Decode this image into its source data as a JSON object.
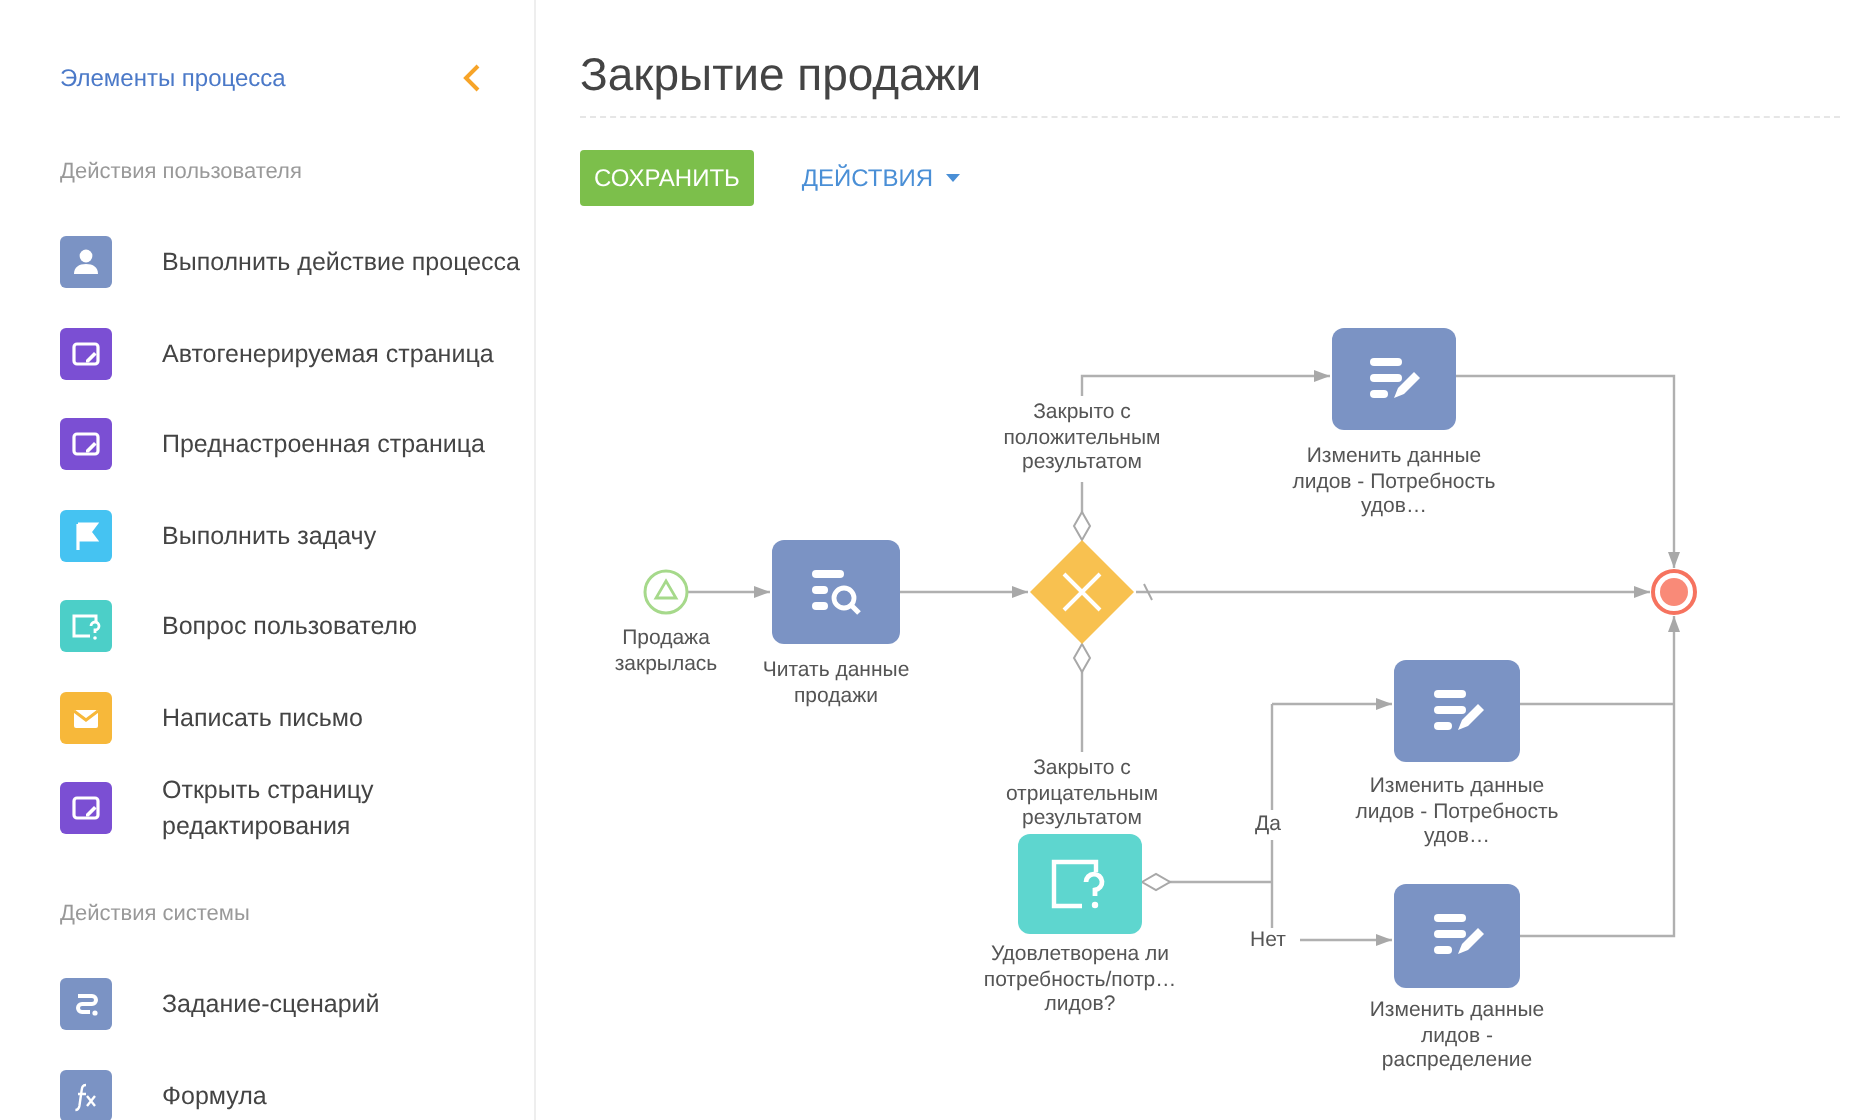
{
  "sidebar": {
    "title": "Элементы процесса",
    "sections": [
      {
        "title": "Действия пользователя",
        "items": [
          {
            "label": "Выполнить действие процесса",
            "kind": "user",
            "color": "#7b93c4"
          },
          {
            "label": "Автогенерируемая страница",
            "kind": "page",
            "color": "#7b4fd3"
          },
          {
            "label": "Преднастроенная страница",
            "kind": "page",
            "color": "#7b4fd3"
          },
          {
            "label": "Выполнить задачу",
            "kind": "flag",
            "color": "#45c3f2"
          },
          {
            "label": "Вопрос пользователю",
            "kind": "question",
            "color": "#4ccfc8"
          },
          {
            "label": "Написать письмо",
            "kind": "mail",
            "color": "#f7b83a"
          },
          {
            "label": "Открыть страницу редактирования",
            "kind": "page",
            "color": "#7b4fd3"
          }
        ]
      },
      {
        "title": "Действия системы",
        "items": [
          {
            "label": "Задание-сценарий",
            "kind": "script",
            "color": "#7b93c4"
          },
          {
            "label": "Формула",
            "kind": "formula",
            "color": "#7b93c4"
          }
        ]
      }
    ]
  },
  "page": {
    "title": "Закрытие продажи",
    "buttons": [
      {
        "label": "СОХРАНИТЬ",
        "kind": "primary"
      },
      {
        "label": "ДЕЙСТВИЯ",
        "kind": "menu"
      }
    ]
  },
  "diagram": {
    "nodes": [
      {
        "kind": "start",
        "label": "Продажа закрылась"
      },
      {
        "kind": "read",
        "label": "Читать данные продажи"
      },
      {
        "kind": "gateway"
      },
      {
        "kind": "update",
        "label": "Изменить данные лидов - Потребность удов…"
      },
      {
        "kind": "end"
      },
      {
        "kind": "question",
        "label": "Удовлетворена ли потребность/потр… лидов?"
      },
      {
        "kind": "update",
        "label": "Изменить данные лидов - Потребность удов…"
      },
      {
        "kind": "update",
        "label": "Изменить данные лидов - распределение"
      }
    ],
    "flow_labels": [
      "Закрыто с положительным результатом",
      "Закрыто с отрицательным результатом",
      "Да",
      "Нет"
    ]
  }
}
